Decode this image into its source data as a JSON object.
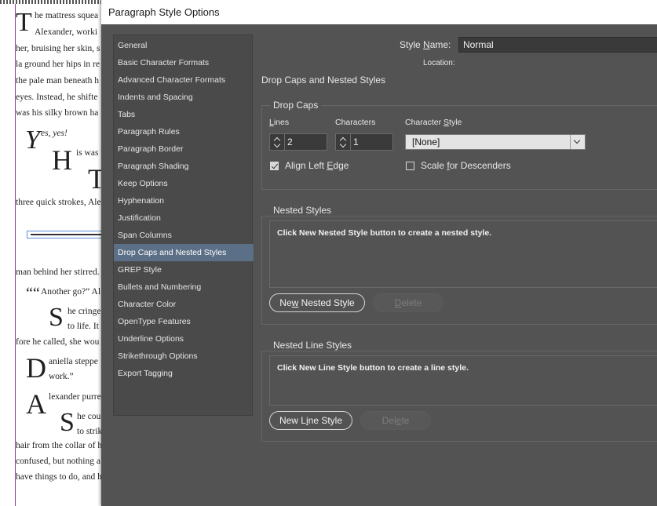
{
  "document": {
    "lines": [
      {
        "text": "he mattress squea",
        "cls": ""
      },
      {
        "text": "Alexander, worki",
        "cls": ""
      },
      {
        "text": "her, bruising her skin, s",
        "cls": ""
      },
      {
        "text": "la ground her hips in re",
        "cls": ""
      },
      {
        "text": "the pale man beneath h",
        "cls": ""
      },
      {
        "text": "eyes. Instead, he shifte",
        "cls": ""
      },
      {
        "text": "was his silky brown ha",
        "cls": ""
      },
      {
        "text": "es, yes!",
        "cls": "it"
      },
      {
        "text": "is was t",
        "cls": ""
      },
      {
        "text": "three quick strokes, Ale",
        "cls": ""
      },
      {
        "text": "man behind her stirred.",
        "cls": ""
      },
      {
        "text": "Another go?” Al",
        "cls": ""
      },
      {
        "text": "he cringe",
        "cls": ""
      },
      {
        "text": "to life. It",
        "cls": ""
      },
      {
        "text": "fore he called, she wou",
        "cls": ""
      },
      {
        "text": "aniella steppe",
        "cls": ""
      },
      {
        "text": "work.”",
        "cls": ""
      },
      {
        "text": "lexander purre",
        "cls": ""
      },
      {
        "text": "he cou",
        "cls": ""
      },
      {
        "text": "to strik",
        "cls": ""
      },
      {
        "text": "hair from the collar of h",
        "cls": ""
      },
      {
        "text": "confused, but nothing a",
        "cls": ""
      },
      {
        "text": "have things to do, and h",
        "cls": ""
      }
    ],
    "caps": {
      "T1": "T",
      "Y": "Y",
      "H": "H",
      "T2": "T",
      "quote": "““",
      "S1": "S",
      "D": "D",
      "A": "A",
      "S2": "S"
    }
  },
  "dialog": {
    "title": "Paragraph Style Options",
    "categories": [
      "General",
      "Basic Character Formats",
      "Advanced Character Formats",
      "Indents and Spacing",
      "Tabs",
      "Paragraph Rules",
      "Paragraph Border",
      "Paragraph Shading",
      "Keep Options",
      "Hyphenation",
      "Justification",
      "Span Columns",
      "Drop Caps and Nested Styles",
      "GREP Style",
      "Bullets and Numbering",
      "Character Color",
      "OpenType Features",
      "Underline Options",
      "Strikethrough Options",
      "Export Tagging"
    ],
    "selected_category": "Drop Caps and Nested Styles",
    "style_name_label_pre": "Style ",
    "style_name_label_mnemonic": "N",
    "style_name_label_post": "ame:",
    "style_name_value": "Normal",
    "location_label": "Location:",
    "section_title": "Drop Caps and Nested Styles",
    "drop_caps": {
      "group_title": "Drop Caps",
      "lines_label": "Lines",
      "lines_label_mnemonic": "L",
      "lines_label_rest": "ines",
      "lines_value": "2",
      "characters_label": "Characters",
      "characters_value": "1",
      "char_style_label_pre": "Character ",
      "char_style_label_mnemonic": "S",
      "char_style_label_post": "tyle",
      "char_style_value": "[None]",
      "align_left_pre": "Align Left ",
      "align_left_mnemonic": "E",
      "align_left_post": "dge",
      "align_left_checked": true,
      "scale_pre": "Scale ",
      "scale_mnemonic": "f",
      "scale_post": "or Descenders",
      "scale_checked": false
    },
    "nested_styles": {
      "group_title": "Nested Styles",
      "message": "Click New Nested Style button to create a nested style.",
      "new_pre": "Ne",
      "new_mnemonic": "w",
      "new_post": " Nested Style",
      "delete_label": "Delete",
      "delete_mnemonic": "D",
      "delete_rest": "elete"
    },
    "nested_line_styles": {
      "group_title": "Nested Line Styles",
      "message": "Click New Line Style button to create a line style.",
      "new_pre": "New L",
      "new_mnemonic": "i",
      "new_post": "ne Style",
      "delete_pre": "Del",
      "delete_mnemonic": "e",
      "delete_post": "te"
    }
  }
}
